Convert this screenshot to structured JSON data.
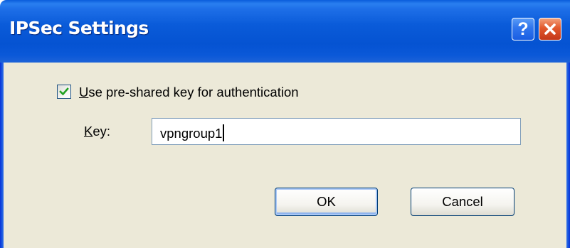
{
  "window": {
    "title": "IPSec Settings",
    "help_label": "?",
    "close_icon": "close-x-icon",
    "colors": {
      "titlebar": "#0a5bd9",
      "body": "#ece9d8",
      "close": "#e2582b",
      "check": "#21a121"
    }
  },
  "auth": {
    "use_psk_checked": true,
    "use_psk_access_key": "U",
    "use_psk_label_rest": "se pre-shared key for authentication",
    "key_access_key": "K",
    "key_label_rest": "ey:",
    "key_value": "vpngroup1"
  },
  "buttons": {
    "ok_label": "OK",
    "cancel_label": "Cancel"
  }
}
